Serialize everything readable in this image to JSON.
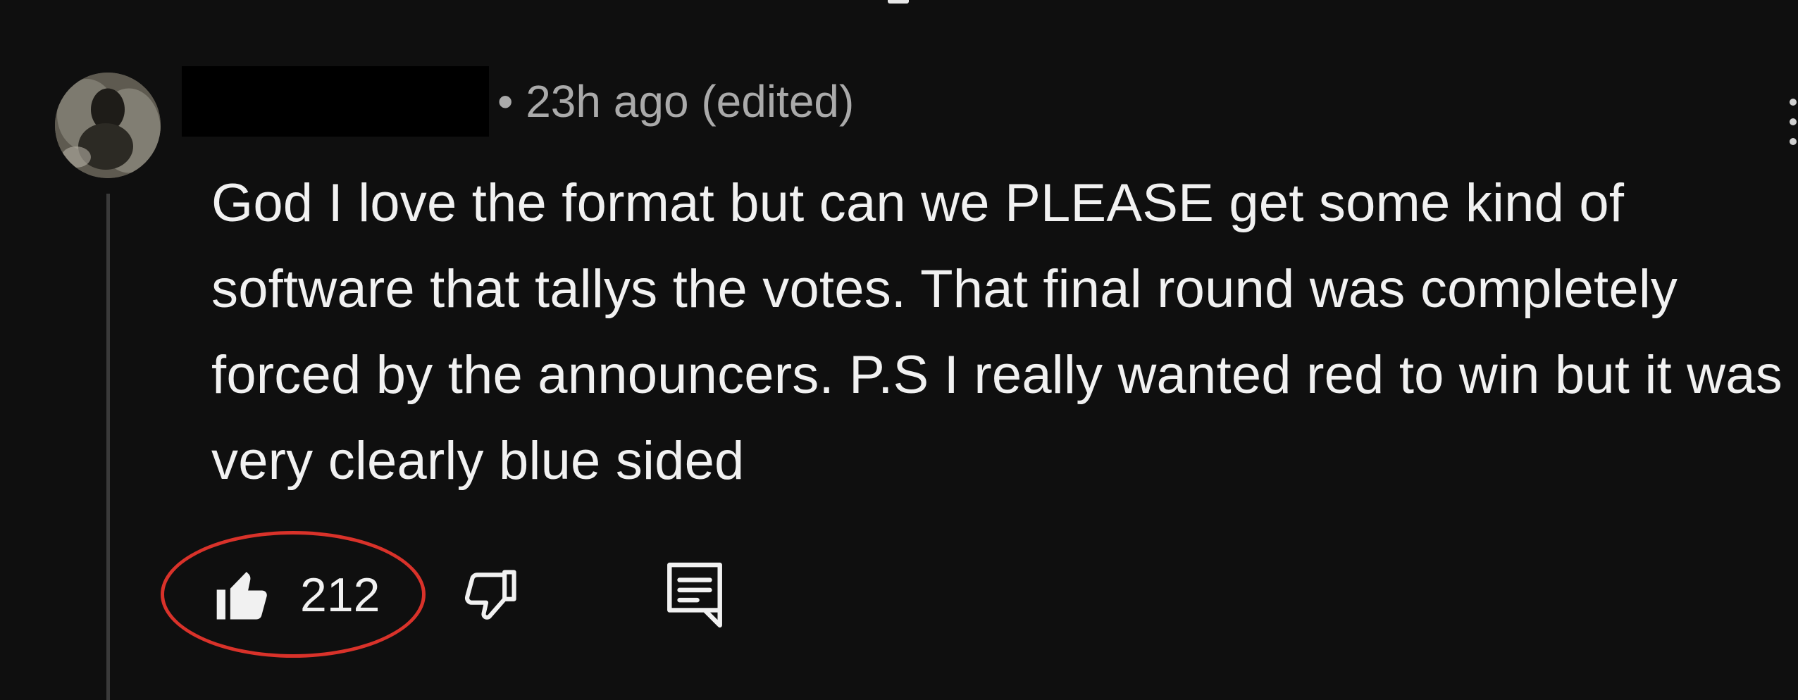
{
  "comment": {
    "author_redacted": true,
    "meta": "• 23h ago (edited)",
    "text": "God I love the format but can we PLEASE get some kind of software that tallys the votes. That final round was completely forced by the announcers. P.S I really wanted red to win but it was very clearly blue sided",
    "actions": {
      "like_icon": "thumbs-up-icon",
      "like_count": "212",
      "dislike_icon": "thumbs-down-icon",
      "reply_icon": "reply-comment-icon"
    }
  },
  "annotation": {
    "highlight_color": "#d9322a"
  },
  "colors": {
    "background": "#0f0f0f",
    "text_primary": "#f1f1f1",
    "text_secondary": "#aaaaaa",
    "thread_line": "#3a3a3a"
  }
}
